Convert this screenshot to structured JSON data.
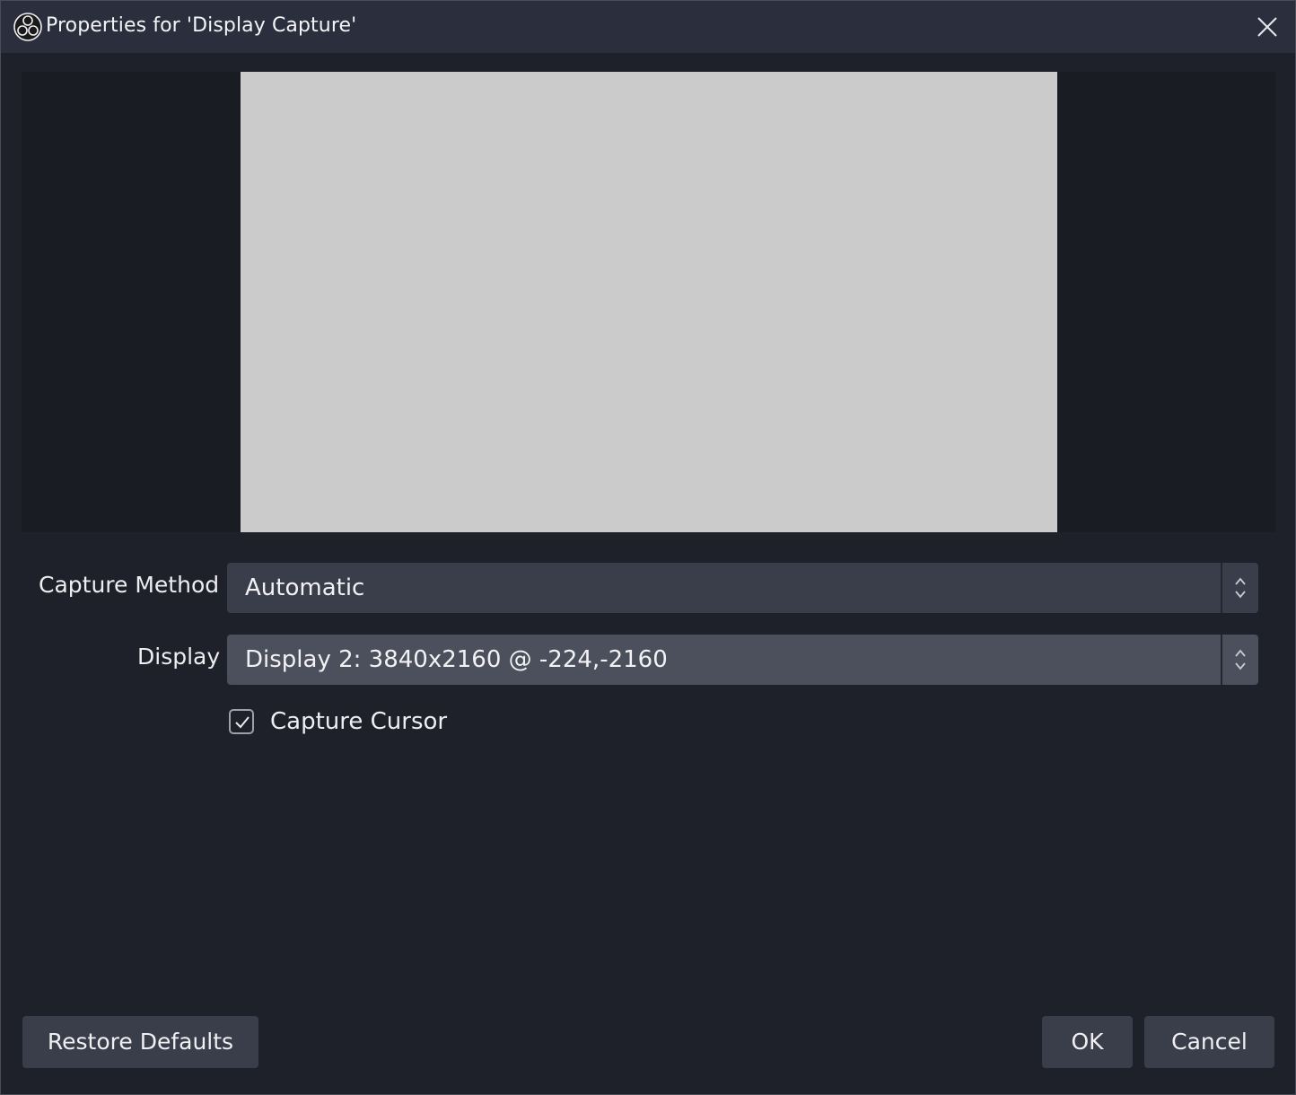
{
  "window": {
    "title": "Properties for 'Display Capture'",
    "app_icon": "obs-logo-icon",
    "close_icon": "close-icon"
  },
  "form": {
    "capture_method": {
      "label": "Capture Method",
      "value": "Automatic"
    },
    "display": {
      "label": "Display",
      "value": "Display 2: 3840x2160 @ -224,-2160"
    },
    "capture_cursor": {
      "label": "Capture Cursor",
      "checked": true
    }
  },
  "buttons": {
    "restore_defaults": "Restore Defaults",
    "ok": "OK",
    "cancel": "Cancel"
  },
  "colors": {
    "background": "#1f212a",
    "titlebar": "#2b2f3d",
    "preview_bg": "#1a1c23",
    "preview_canvas": "#cbcbcb",
    "combo_bg_1": "#3a3d4a",
    "combo_bg_2": "#4c4f5c",
    "button_bg": "#3a3d4a"
  }
}
